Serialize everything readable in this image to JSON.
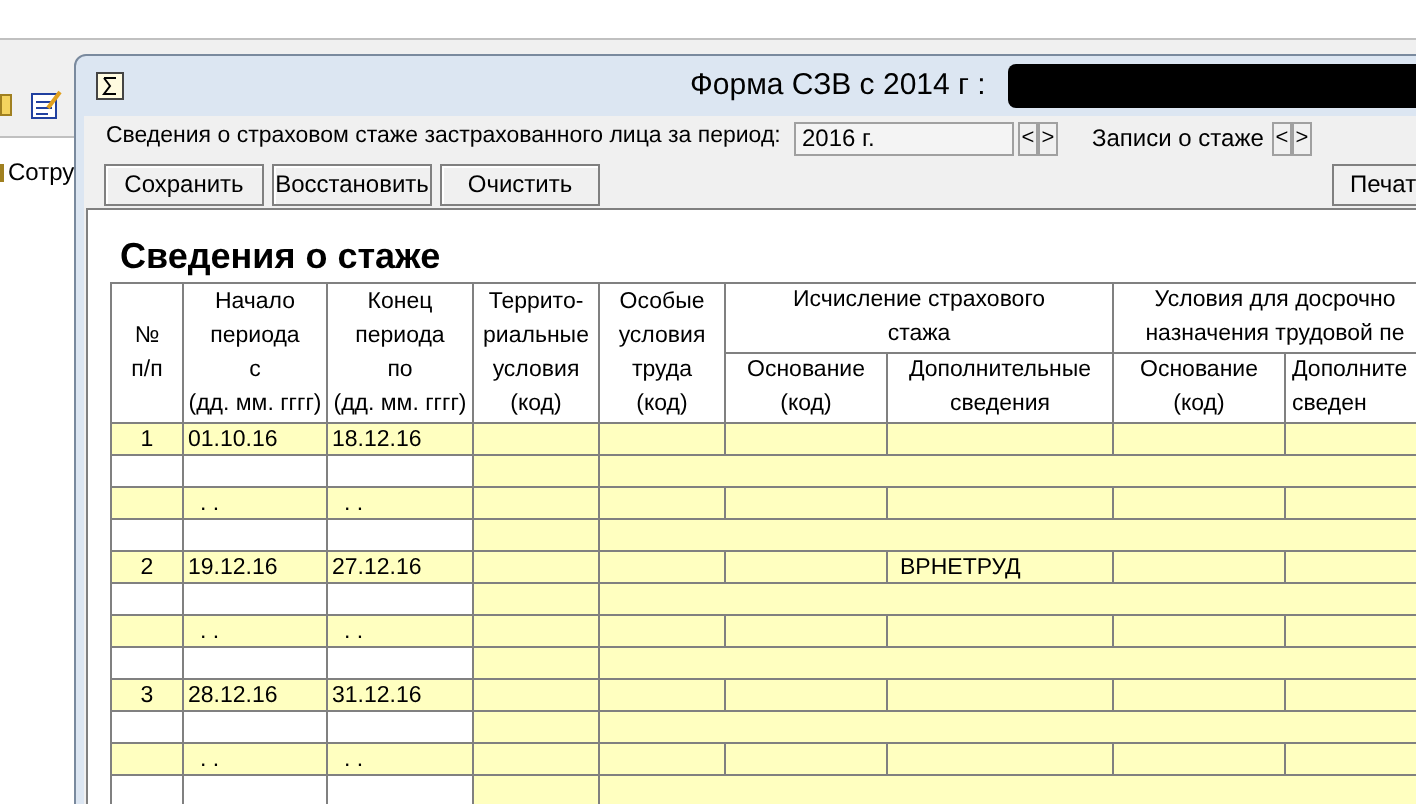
{
  "background_app": {
    "sidebar_item": "Сотру"
  },
  "window": {
    "title": "Форма СЗВ с 2014 г :"
  },
  "period": {
    "label": "Сведения о страховом стаже застрахованного лица за период:",
    "value": "2016 г.",
    "prev": "<",
    "next": ">"
  },
  "records_nav": {
    "label": "Записи о стаже",
    "prev": "<",
    "next": ">"
  },
  "buttons": [
    "Сохранить",
    "Восстановить",
    "Очистить"
  ],
  "right_buttons": [
    "Печат"
  ],
  "heading": "Сведения о стаже",
  "table": {
    "columns": [
      {
        "label": "№\nп/п"
      },
      {
        "label": "Начало\nпериода\nс\n(дд. мм. гггг)"
      },
      {
        "label": "Конец\nпериода\nпо\n(дд. мм. гггг)"
      },
      {
        "label": "Террито-\nриальные\nусловия\n(код)"
      },
      {
        "label": "Особые\nусловия\nтруда\n(код)"
      },
      {
        "label": "Исчисление страхового\nстажа",
        "children": [
          {
            "label": "Основание\n(код)"
          },
          {
            "label": "Дополнительные\nсведения"
          }
        ]
      },
      {
        "label": "Условия для досрочно\nназначения трудовой пе",
        "children": [
          {
            "label": "Основание\n(код)"
          },
          {
            "label": "Дополните\nсведен"
          }
        ]
      }
    ],
    "records": [
      {
        "number": "1",
        "start": "01.10.16",
        "end": "18.12.16",
        "start_2": ". .",
        "end_2": ". ."
      },
      {
        "number": "2",
        "start": "19.12.16",
        "end": "27.12.16",
        "additional_info": "ВРНЕТРУД",
        "start_2": ". .",
        "end_2": ". ."
      },
      {
        "number": "3",
        "start": "28.12.16",
        "end": "31.12.16",
        "start_2": ". .",
        "end_2": ". ."
      }
    ]
  }
}
